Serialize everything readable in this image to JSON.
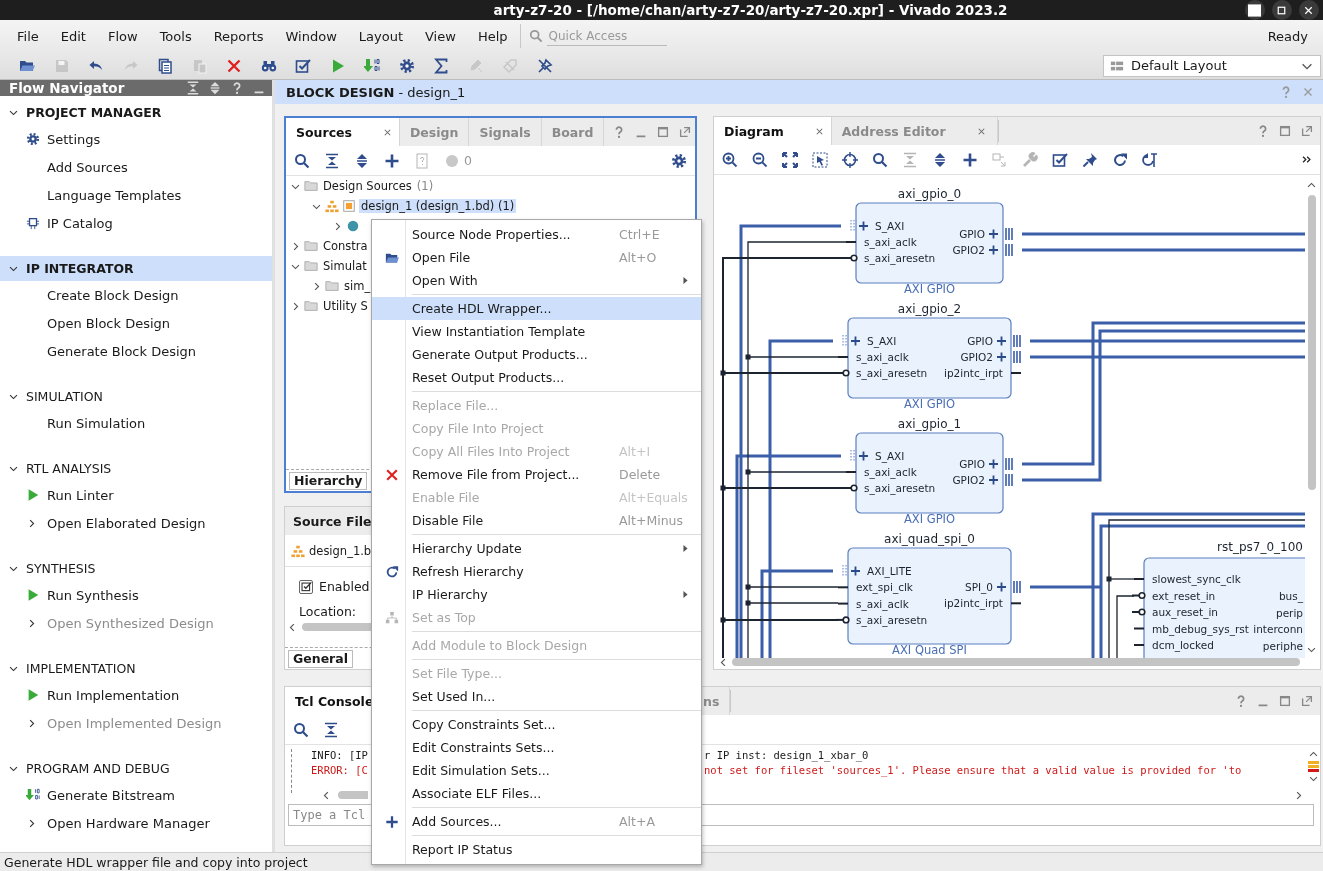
{
  "window": {
    "title": "arty-z7-20 - [/home/chan/arty-z7-20/arty-z7-20.xpr] - Vivado 2023.2"
  },
  "menu_bar": [
    "File",
    "Edit",
    "Flow",
    "Tools",
    "Reports",
    "Window",
    "Layout",
    "View",
    "Help"
  ],
  "quick_access": {
    "placeholder": "Quick Access"
  },
  "status_indicator": "Ready",
  "main_toolbar": [
    {
      "disabled": false
    },
    {
      "disabled": true
    },
    {
      "disabled": false
    },
    {
      "disabled": true
    },
    {
      "disabled": false
    },
    {
      "disabled": true
    },
    {
      "disabled": false
    },
    {
      "disabled": false
    },
    {
      "disabled": false
    },
    {
      "disabled": false
    },
    {
      "disabled": false
    },
    {
      "disabled": false
    },
    {
      "disabled": false
    },
    {
      "disabled": true
    },
    {
      "disabled": true
    },
    {
      "disabled": false
    }
  ],
  "layout_select": {
    "value": "Default Layout"
  },
  "flow_navigator": {
    "title": "Flow Navigator",
    "sections": [
      {
        "title": "PROJECT MANAGER",
        "expanded": true,
        "selected": false,
        "emphasized": true,
        "items": [
          {
            "label": "Settings",
            "kind": "settings",
            "disabled": false
          },
          {
            "label": "Add Sources",
            "kind": "plain",
            "disabled": false
          },
          {
            "label": "Language Templates",
            "kind": "plain",
            "disabled": false
          },
          {
            "label": "IP Catalog",
            "kind": "catalog",
            "disabled": false
          }
        ]
      },
      {
        "title": "IP INTEGRATOR",
        "expanded": true,
        "selected": true,
        "emphasized": true,
        "items": [
          {
            "label": "Create Block Design",
            "kind": "plain",
            "disabled": false
          },
          {
            "label": "Open Block Design",
            "kind": "plain",
            "disabled": false
          },
          {
            "label": "Generate Block Design",
            "kind": "plain",
            "disabled": false
          }
        ]
      },
      {
        "title": "SIMULATION",
        "expanded": true,
        "selected": false,
        "emphasized": false,
        "items": [
          {
            "label": "Run Simulation",
            "kind": "plain",
            "disabled": false
          }
        ]
      },
      {
        "title": "RTL ANALYSIS",
        "expanded": true,
        "selected": false,
        "emphasized": false,
        "items": [
          {
            "label": "Run Linter",
            "kind": "run",
            "disabled": false
          },
          {
            "label": "Open Elaborated Design",
            "kind": "expandable",
            "disabled": false
          }
        ]
      },
      {
        "title": "SYNTHESIS",
        "expanded": true,
        "selected": false,
        "emphasized": false,
        "items": [
          {
            "label": "Run Synthesis",
            "kind": "run",
            "disabled": false
          },
          {
            "label": "Open Synthesized Design",
            "kind": "expandable",
            "disabled": true
          }
        ]
      },
      {
        "title": "IMPLEMENTATION",
        "expanded": true,
        "selected": false,
        "emphasized": false,
        "items": [
          {
            "label": "Run Implementation",
            "kind": "run",
            "disabled": false
          },
          {
            "label": "Open Implemented Design",
            "kind": "expandable",
            "disabled": true
          }
        ]
      },
      {
        "title": "PROGRAM AND DEBUG",
        "expanded": true,
        "selected": false,
        "emphasized": false,
        "items": [
          {
            "label": "Generate Bitstream",
            "kind": "bitstream",
            "disabled": false
          },
          {
            "label": "Open Hardware Manager",
            "kind": "expandable",
            "disabled": false
          }
        ]
      }
    ]
  },
  "block_design": {
    "title": "**BLOCK DESIGN** - design_1"
  },
  "sources": {
    "tabs": [
      {
        "label": "Sources",
        "selected": true
      },
      {
        "label": "Design",
        "selected": false
      },
      {
        "label": "Signals",
        "selected": false
      },
      {
        "label": "Board",
        "selected": false
      }
    ],
    "count": "0",
    "tree": [
      {
        "label": "Design Sources",
        "count": "(1)",
        "kind": "folder",
        "expanded": true,
        "selected": false,
        "children": [
          {
            "label": "design_1 (design_1.bd) (1)",
            "kind": "block_design",
            "expanded": true,
            "selected": true,
            "children": [
              {
                "kind": "ip",
                "expanded": false,
                "selected": false
              }
            ]
          }
        ]
      },
      {
        "label": "Constra",
        "kind": "folder",
        "expanded": false,
        "selected": false
      },
      {
        "label": "Simulat",
        "kind": "folder",
        "expanded": true,
        "selected": false,
        "children": [
          {
            "label": "sim_",
            "kind": "folder",
            "expanded": false,
            "selected": false
          }
        ]
      },
      {
        "label": "Utility S",
        "kind": "folder",
        "expanded": false,
        "selected": false
      }
    ],
    "bottom_tab": "Hierarchy"
  },
  "properties": {
    "title": "Source File",
    "file": "design_1.b",
    "enabled": {
      "label": "Enabled",
      "checked": true
    },
    "location_label": "Location:",
    "bottom_tab": "General"
  },
  "diagram": {
    "tabs": [
      {
        "label": "Diagram",
        "selected": true
      },
      {
        "label": "Address Editor",
        "selected": false
      }
    ],
    "toolbar": [
      {
        "disabled": false
      },
      {
        "disabled": false
      },
      {
        "disabled": false
      },
      {
        "disabled": false
      },
      {
        "disabled": false
      },
      {
        "disabled": false
      },
      {
        "disabled": true
      },
      {
        "disabled": false
      },
      {
        "disabled": false
      },
      {
        "disabled": true
      },
      {
        "disabled": true
      },
      {
        "disabled": false
      },
      {
        "disabled": false
      },
      {
        "disabled": false
      },
      {
        "disabled": false
      }
    ],
    "blocks": [
      {
        "name": "axi_gpio_0",
        "type": "AXI GPIO",
        "left_ports": [
          {
            "label": "S_AXI",
            "kind": "bus"
          },
          {
            "label": "s_axi_aclk",
            "kind": "signal"
          },
          {
            "label": "s_axi_aresetn",
            "kind": "reset"
          }
        ],
        "right_ports": [
          {
            "label": "GPIO",
            "kind": "bus"
          },
          {
            "label": "GPIO2",
            "kind": "bus"
          }
        ]
      },
      {
        "name": "axi_gpio_2",
        "type": "AXI GPIO",
        "left_ports": [
          {
            "label": "S_AXI",
            "kind": "bus"
          },
          {
            "label": "s_axi_aclk",
            "kind": "signal"
          },
          {
            "label": "s_axi_aresetn",
            "kind": "reset"
          }
        ],
        "right_ports": [
          {
            "label": "GPIO",
            "kind": "bus"
          },
          {
            "label": "GPIO2",
            "kind": "bus"
          },
          {
            "label": "ip2intc_irpt",
            "kind": "signal"
          }
        ]
      },
      {
        "name": "axi_gpio_1",
        "type": "AXI GPIO",
        "left_ports": [
          {
            "label": "S_AXI",
            "kind": "bus"
          },
          {
            "label": "s_axi_aclk",
            "kind": "signal"
          },
          {
            "label": "s_axi_aresetn",
            "kind": "reset"
          }
        ],
        "right_ports": [
          {
            "label": "GPIO",
            "kind": "bus"
          },
          {
            "label": "GPIO2",
            "kind": "bus"
          }
        ]
      },
      {
        "name": "axi_quad_spi_0",
        "type": "AXI Quad SPI",
        "left_ports": [
          {
            "label": "AXI_LITE",
            "kind": "bus"
          },
          {
            "label": "ext_spi_clk",
            "kind": "signal"
          },
          {
            "label": "s_axi_aclk",
            "kind": "signal"
          },
          {
            "label": "s_axi_aresetn",
            "kind": "reset"
          }
        ],
        "right_ports": [
          {
            "label": "SPI_0",
            "kind": "bus"
          },
          {
            "label": "ip2intc_irpt",
            "kind": "signal"
          }
        ]
      },
      {
        "name": "rst_ps7_0_100",
        "left_ports": [
          {
            "label": "slowest_sync_clk",
            "kind": "signal"
          },
          {
            "label": "ext_reset_in",
            "kind": "reset"
          },
          {
            "label": "aux_reset_in",
            "kind": "reset"
          },
          {
            "label": "mb_debug_sys_rst",
            "kind": "signal"
          },
          {
            "label": "dcm_locked",
            "kind": "signal"
          }
        ],
        "right_ports": [
          {
            "label": "bus_",
            "kind": "cut"
          },
          {
            "label": "perip",
            "kind": "cut"
          },
          {
            "label": "interconn",
            "kind": "cut"
          },
          {
            "label": "periphe",
            "kind": "cut"
          }
        ]
      }
    ]
  },
  "tcl_console": {
    "tabs": [
      {
        "label": "Tcl Console",
        "selected": true
      },
      {
        "label": "ns",
        "selected": false
      }
    ],
    "lines": [
      {
        "kind": "info",
        "left": "INFO: [IP",
        "right": "r IP inst: design_1_xbar_0"
      },
      {
        "kind": "error",
        "left": "ERROR: [C",
        "right": "not set for fileset 'sources_1'. Please ensure that a valid value is provided for 'to"
      }
    ],
    "input": {
      "placeholder": "Type a Tcl"
    }
  },
  "context_menu": {
    "groups": [
      [
        {
          "label": "Source Node Properties...",
          "shortcut": "Ctrl+E",
          "kind": "plain",
          "disabled": false,
          "submenu": false,
          "selected": false
        },
        {
          "label": "Open File",
          "shortcut": "Alt+O",
          "kind": "open",
          "disabled": false,
          "submenu": false,
          "selected": false
        },
        {
          "label": "Open With",
          "kind": "plain",
          "disabled": false,
          "submenu": true,
          "selected": false
        }
      ],
      [
        {
          "label": "Create HDL Wrapper...",
          "kind": "plain",
          "disabled": false,
          "submenu": false,
          "selected": true
        },
        {
          "label": "View Instantiation Template",
          "kind": "plain",
          "disabled": false,
          "submenu": false,
          "selected": false
        },
        {
          "label": "Generate Output Products...",
          "kind": "plain",
          "disabled": false,
          "submenu": false,
          "selected": false
        },
        {
          "label": "Reset Output Products...",
          "kind": "plain",
          "disabled": false,
          "submenu": false,
          "selected": false
        }
      ],
      [
        {
          "label": "Replace File...",
          "kind": "plain",
          "disabled": true,
          "submenu": false,
          "selected": false
        },
        {
          "label": "Copy File Into Project",
          "kind": "plain",
          "disabled": true,
          "submenu": false,
          "selected": false
        },
        {
          "label": "Copy All Files Into Project",
          "shortcut": "Alt+I",
          "kind": "plain",
          "disabled": true,
          "submenu": false,
          "selected": false
        },
        {
          "label": "Remove File from Project...",
          "shortcut": "Delete",
          "kind": "remove",
          "disabled": false,
          "submenu": false,
          "selected": false
        },
        {
          "label": "Enable File",
          "shortcut": "Alt+Equals",
          "kind": "plain",
          "disabled": true,
          "submenu": false,
          "selected": false
        },
        {
          "label": "Disable File",
          "shortcut": "Alt+Minus",
          "kind": "plain",
          "disabled": false,
          "submenu": false,
          "selected": false
        }
      ],
      [
        {
          "label": "Hierarchy Update",
          "kind": "plain",
          "disabled": false,
          "submenu": true,
          "selected": false
        },
        {
          "label": "Refresh Hierarchy",
          "kind": "refresh",
          "disabled": false,
          "submenu": false,
          "selected": false
        },
        {
          "label": "IP Hierarchy",
          "kind": "plain",
          "disabled": false,
          "submenu": true,
          "selected": false
        },
        {
          "label": "Set as Top",
          "kind": "hierarchy",
          "disabled": true,
          "submenu": false,
          "selected": false
        }
      ],
      [
        {
          "label": "Add Module to Block Design",
          "kind": "plain",
          "disabled": true,
          "submenu": false,
          "selected": false
        }
      ],
      [
        {
          "label": "Set File Type...",
          "kind": "plain",
          "disabled": true,
          "submenu": false,
          "selected": false
        },
        {
          "label": "Set Used In...",
          "kind": "plain",
          "disabled": false,
          "submenu": false,
          "selected": false
        }
      ],
      [
        {
          "label": "Copy Constraints Set...",
          "kind": "plain",
          "disabled": false,
          "submenu": false,
          "selected": false
        },
        {
          "label": "Edit Constraints Sets...",
          "kind": "plain",
          "disabled": false,
          "submenu": false,
          "selected": false
        },
        {
          "label": "Edit Simulation Sets...",
          "kind": "plain",
          "disabled": false,
          "submenu": false,
          "selected": false
        },
        {
          "label": "Associate ELF Files...",
          "kind": "plain",
          "disabled": false,
          "submenu": false,
          "selected": false
        }
      ],
      [
        {
          "label": "Add Sources...",
          "shortcut": "Alt+A",
          "kind": "add",
          "disabled": false,
          "submenu": false,
          "selected": false
        }
      ],
      [
        {
          "label": "Report IP Status",
          "kind": "plain",
          "disabled": false,
          "submenu": false,
          "selected": false
        }
      ]
    ]
  },
  "status_bar": "Generate HDL wrapper file and copy into project"
}
